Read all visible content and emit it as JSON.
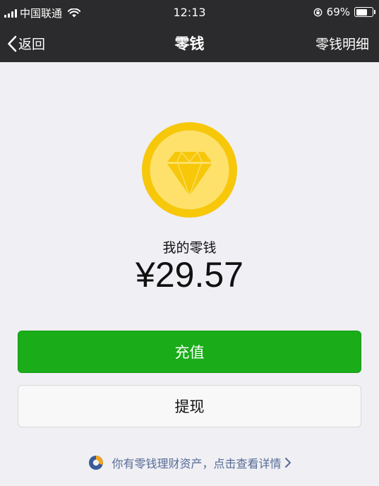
{
  "status_bar": {
    "carrier": "中国联通",
    "time": "12:13",
    "battery_percent": "69%",
    "battery_level": 0.69
  },
  "nav": {
    "back_label": "返回",
    "title": "零钱",
    "right_label": "零钱明细"
  },
  "wallet": {
    "label": "我的零钱",
    "amount": "¥29.57"
  },
  "actions": {
    "recharge_label": "充值",
    "withdraw_label": "提现"
  },
  "promo": {
    "text": "你有零钱理财资产，点击查看详情"
  },
  "colors": {
    "nav_bg": "#2b2b2d",
    "page_bg": "#efeff4",
    "primary_green": "#1aad19",
    "coin_outer": "#f7c70a",
    "coin_inner": "#fde16a",
    "link_blue": "#576b95"
  },
  "icons": [
    "signal-icon",
    "wifi-icon",
    "rotation-lock-icon",
    "battery-icon",
    "back-chevron-icon",
    "diamond-coin-icon",
    "wealth-icon",
    "chevron-right-icon"
  ]
}
